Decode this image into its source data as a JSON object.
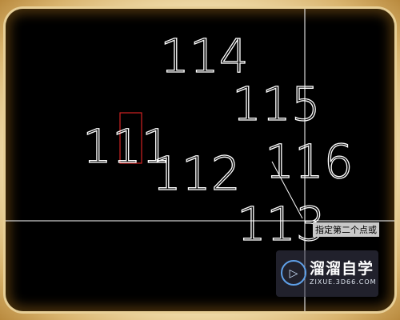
{
  "drawing": {
    "labels": [
      "114",
      "115",
      "111",
      "112",
      "116",
      "113"
    ]
  },
  "command_prompt": "指定第二个点或",
  "watermark": {
    "brand": "溜溜自学",
    "url": "ZIXUE.3D66.COM",
    "logo_icon": "play-icon"
  },
  "colors": {
    "background": "#000000",
    "text": "#ffffff",
    "selection_box": "#d22222",
    "frame": "#f3e4b8"
  }
}
